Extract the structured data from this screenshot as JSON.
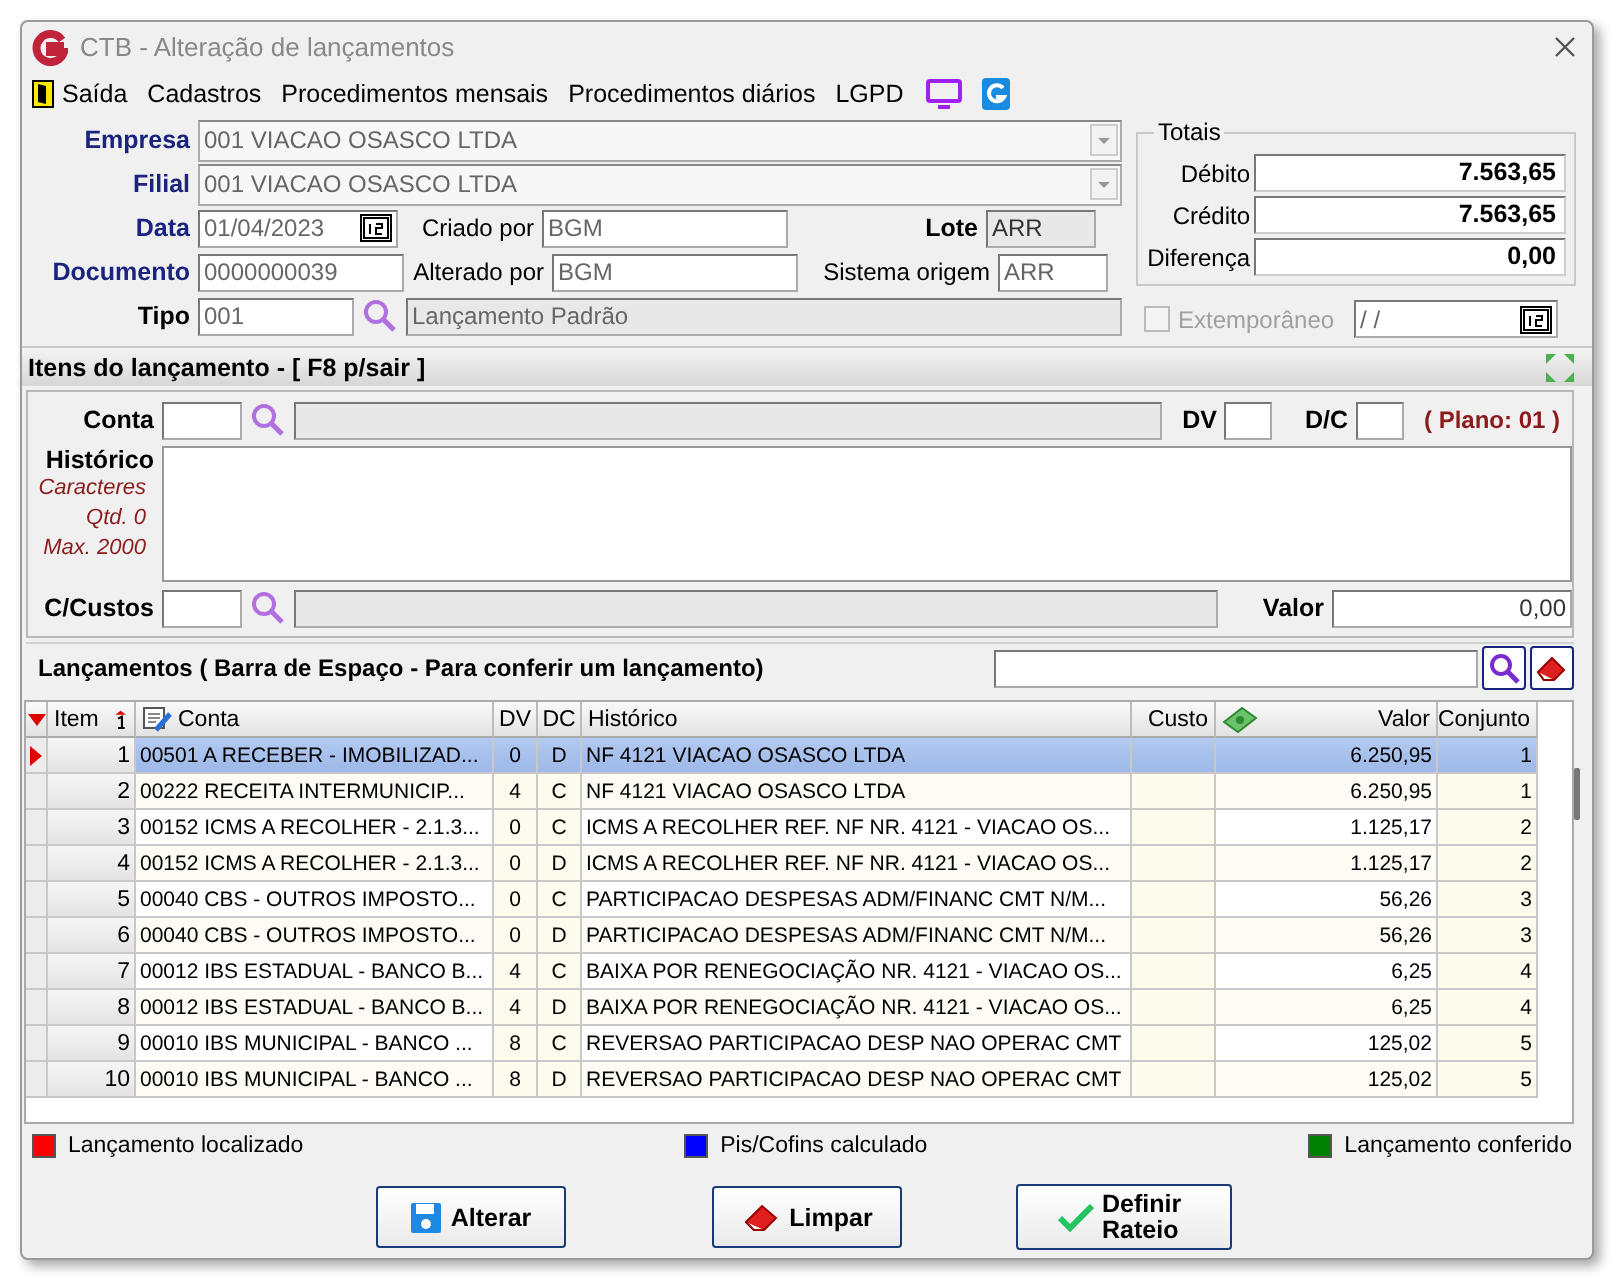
{
  "window": {
    "title": "CTB - Alteração de lançamentos"
  },
  "menu": [
    {
      "label": "Saída",
      "kind": "exit"
    },
    {
      "label": "Cadastros",
      "kind": "text"
    },
    {
      "label": "Procedimentos mensais",
      "kind": "text"
    },
    {
      "label": "Procedimentos diários",
      "kind": "text"
    },
    {
      "label": "LGPD",
      "kind": "text"
    }
  ],
  "header": {
    "empresa": {
      "label": "Empresa",
      "value": "001 VIACAO OSASCO LTDA"
    },
    "filial": {
      "label": "Filial",
      "value": "001 VIACAO OSASCO LTDA"
    },
    "data": {
      "label": "Data",
      "value": "01/04/2023"
    },
    "criado_por": {
      "label": "Criado por",
      "value": "BGM"
    },
    "lote": {
      "label": "Lote",
      "value": "ARR"
    },
    "documento": {
      "label": "Documento",
      "value": "0000000039"
    },
    "alterado_por": {
      "label": "Alterado por",
      "value": "BGM"
    },
    "sistema_origem": {
      "label": "Sistema origem",
      "value": "ARR"
    },
    "tipo": {
      "label": "Tipo",
      "value": "001",
      "description": "Lançamento Padrão"
    }
  },
  "totals": {
    "title": "Totais",
    "rows": [
      {
        "label": "Débito",
        "value": "7.563,65"
      },
      {
        "label": "Crédito",
        "value": "7.563,65"
      },
      {
        "label": "Diferença",
        "value": "0,00"
      }
    ]
  },
  "extemporaneo": {
    "label": "Extemporâneo",
    "checked": false,
    "disabled": true,
    "date": "/ /"
  },
  "items_section": {
    "title": "Itens do lançamento - [ F8 p/sair ]"
  },
  "entry": {
    "conta_label": "Conta",
    "dv_label": "DV",
    "dc_label": "D/C",
    "plano": "( Plano: 01 )",
    "historico_label": "Histórico",
    "char_info": [
      "Caracteres",
      "Qtd. 0",
      "Max. 2000"
    ],
    "custos_label": "C/Custos",
    "valor_label": "Valor",
    "valor": "0,00"
  },
  "lancamentos": {
    "title": "Lançamentos ( Barra de Espaço - Para conferir um lançamento)"
  },
  "table": {
    "columns": [
      "Item",
      "Conta",
      "DV",
      "DC",
      "Histórico",
      "Custo",
      "Valor",
      "Conjunto"
    ],
    "rows": [
      {
        "item": "1",
        "conta": "00501 A RECEBER - IMOBILIZAD...",
        "dv": "0",
        "dc": "D",
        "historico": "NF 4121 VIACAO OSASCO LTDA",
        "valor": "6.250,95",
        "conjunto": "1",
        "selected": true
      },
      {
        "item": "2",
        "conta": "00222 RECEITA INTERMUNICIP...",
        "dv": "4",
        "dc": "C",
        "historico": "NF 4121 VIACAO OSASCO LTDA",
        "valor": "6.250,95",
        "conjunto": "1",
        "selected": false
      },
      {
        "item": "3",
        "conta": "00152 ICMS A RECOLHER - 2.1.3...",
        "dv": "0",
        "dc": "C",
        "historico": "ICMS A RECOLHER REF. NF NR. 4121 - VIACAO OS...",
        "valor": "1.125,17",
        "conjunto": "2",
        "selected": false
      },
      {
        "item": "4",
        "conta": "00152 ICMS A RECOLHER - 2.1.3...",
        "dv": "0",
        "dc": "D",
        "historico": "ICMS A RECOLHER REF. NF NR. 4121 - VIACAO OS...",
        "valor": "1.125,17",
        "conjunto": "2",
        "selected": false
      },
      {
        "item": "5",
        "conta": "00040 CBS - OUTROS IMPOSTO...",
        "dv": "0",
        "dc": "C",
        "historico": "PARTICIPACAO DESPESAS ADM/FINANC CMT N/M...",
        "valor": "56,26",
        "conjunto": "3",
        "selected": false
      },
      {
        "item": "6",
        "conta": "00040 CBS - OUTROS IMPOSTO...",
        "dv": "0",
        "dc": "D",
        "historico": "PARTICIPACAO DESPESAS ADM/FINANC CMT N/M...",
        "valor": "56,26",
        "conjunto": "3",
        "selected": false
      },
      {
        "item": "7",
        "conta": "00012 IBS ESTADUAL - BANCO B...",
        "dv": "4",
        "dc": "C",
        "historico": "BAIXA POR RENEGOCIAÇÃO NR. 4121 - VIACAO OS...",
        "valor": "6,25",
        "conjunto": "4",
        "selected": false
      },
      {
        "item": "8",
        "conta": "00012 IBS ESTADUAL - BANCO B...",
        "dv": "4",
        "dc": "D",
        "historico": "BAIXA POR RENEGOCIAÇÃO NR. 4121 - VIACAO OS...",
        "valor": "6,25",
        "conjunto": "4",
        "selected": false
      },
      {
        "item": "9",
        "conta": "00010 IBS MUNICIPAL - BANCO ...",
        "dv": "8",
        "dc": "C",
        "historico": "REVERSAO PARTICIPACAO DESP NAO OPERAC CMT",
        "valor": "125,02",
        "conjunto": "5",
        "selected": false
      },
      {
        "item": "10",
        "conta": "00010 IBS MUNICIPAL - BANCO ...",
        "dv": "8",
        "dc": "D",
        "historico": "REVERSAO PARTICIPACAO DESP NAO OPERAC CMT",
        "valor": "125,02",
        "conjunto": "5",
        "selected": false
      }
    ]
  },
  "legend": [
    {
      "label": "Lançamento localizado",
      "color": "#ff0000"
    },
    {
      "label": "Pis/Cofins calculado",
      "color": "#0000ff"
    },
    {
      "label": "Lançamento conferido",
      "color": "#008000"
    }
  ],
  "buttons": [
    {
      "label": "Alterar",
      "kind": "save"
    },
    {
      "label": "Limpar",
      "kind": "clear"
    },
    {
      "label": "Definir Rateio",
      "kind": "check"
    }
  ]
}
